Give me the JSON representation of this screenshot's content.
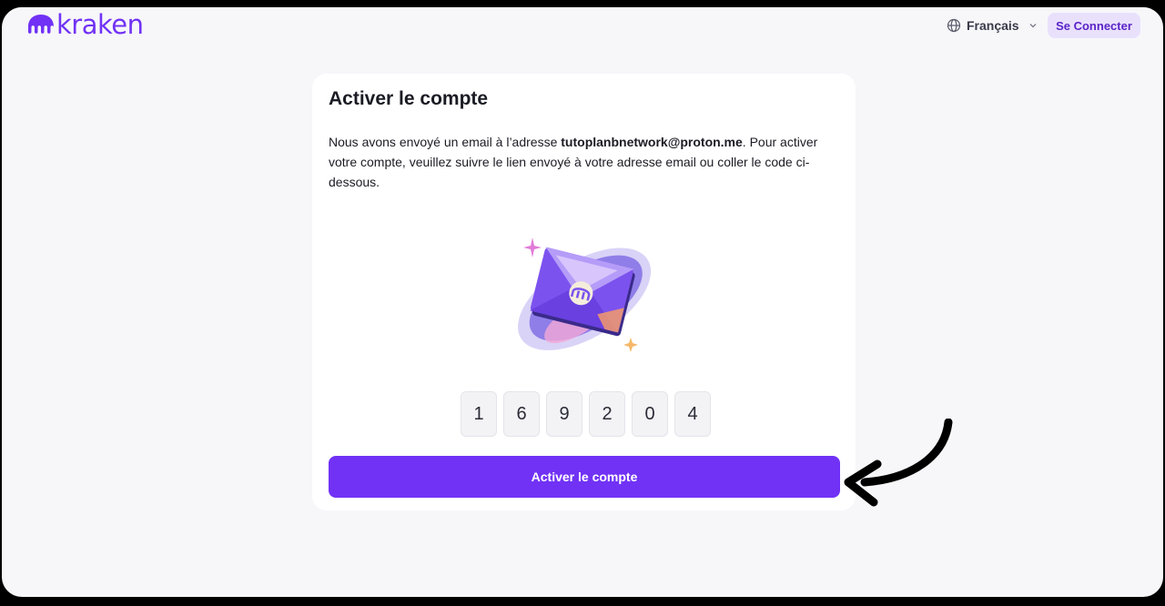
{
  "header": {
    "logo_text": "kraken",
    "language": {
      "icon": "globe-icon",
      "label": "Français",
      "chevron": "chevron-down-icon"
    },
    "connect_label": "Se Connecter"
  },
  "card": {
    "title": "Activer le compte",
    "desc_before": "Nous avons envoyé un email à l’adresse ",
    "email": "tutoplanbnetwork@proton.me",
    "desc_after": ". Pour activer votre compte, veuillez suivre le lien envoyé à votre adresse email ou coller le code ci-dessous.",
    "illustration": "envelope-illustration",
    "code_digits": [
      "1",
      "6",
      "9",
      "2",
      "0",
      "4"
    ],
    "activate_label": "Activer le compte"
  },
  "annotation": {
    "icon": "curved-arrow-icon"
  },
  "colors": {
    "brand": "#7132f5",
    "connect_bg": "#e9e1fc",
    "page_bg": "#f7f7fa"
  }
}
